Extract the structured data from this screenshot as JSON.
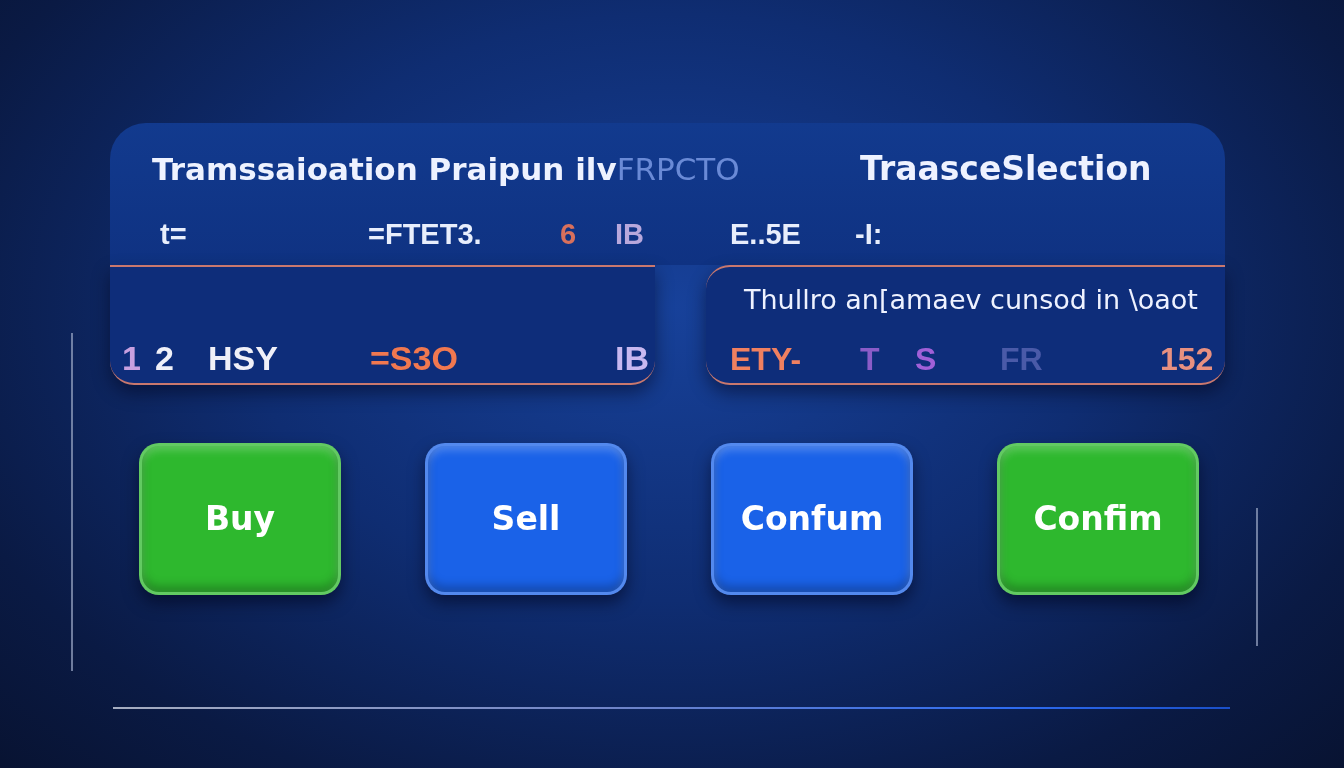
{
  "header": {
    "title": [
      {
        "text": "Tramssaioation Praipun ilv",
        "faded": false
      },
      {
        "text": "FRPCTO",
        "faded": true
      }
    ],
    "side_title": "TraasceSlection",
    "values": [
      {
        "text": "t=",
        "color": "#e8eefc"
      },
      {
        "text": "=FTET3.",
        "color": "#e8eefc"
      },
      {
        "text": "6",
        "color": "#d8705c"
      },
      {
        "text": "IB",
        "color": "#b8a8dc"
      },
      {
        "text": "E..5E",
        "color": "#e8eefc"
      },
      {
        "text": "-I:",
        "color": "#e8eefc"
      }
    ]
  },
  "left_card": {
    "values": [
      {
        "text": "1",
        "color": "#c8a0e0"
      },
      {
        "text": "2",
        "color": "#f0f0f8"
      },
      {
        "text": "HSY",
        "color": "#f0f0f8"
      },
      {
        "text": "=S3O",
        "color": "#f07850"
      },
      {
        "text": "IB",
        "color": "#c8b8f0"
      }
    ]
  },
  "right_card": {
    "text": "Thullro an[amaev cunsod in \\oaot",
    "values": [
      {
        "text": "ETY-",
        "color": "#f08060"
      },
      {
        "text": "T",
        "color": "#8a5cc8"
      },
      {
        "text": "S",
        "color": "#a060d8"
      },
      {
        "text": "FR",
        "color": "#4a5aa8"
      },
      {
        "text": "152",
        "color": "#e89080"
      }
    ]
  },
  "buttons": [
    {
      "label": "Buy",
      "color": "#2eb82e"
    },
    {
      "label": "Sell",
      "color": "#1a62e8"
    },
    {
      "label": "Confum",
      "color": "#1a62e8"
    },
    {
      "label": "Confim",
      "color": "#2eb82e"
    }
  ]
}
